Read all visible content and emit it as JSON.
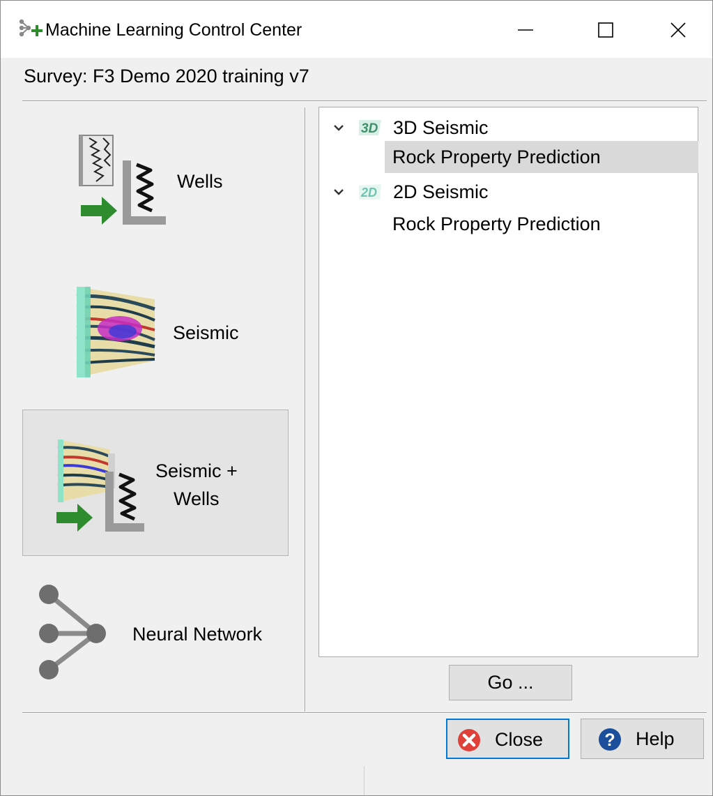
{
  "window": {
    "title": "Machine Learning Control Center",
    "icon": "ml-network-plus-icon",
    "controls": [
      "minimize-icon",
      "maximize-icon",
      "close-icon"
    ]
  },
  "survey_label": "Survey: F3 Demo 2020 training v7",
  "tools": [
    {
      "label": "Wells",
      "icon": "wells-icon",
      "selected": false
    },
    {
      "label": "Seismic",
      "icon": "seismic-icon",
      "selected": false
    },
    {
      "label_line1": "Seismic +",
      "label_line2": "Wells",
      "icon": "seismic-wells-icon",
      "selected": true
    },
    {
      "label": "Neural Network",
      "icon": "neural-network-icon",
      "selected": false
    }
  ],
  "tree": {
    "groups": [
      {
        "badge": "3D",
        "label": "3D Seismic",
        "expanded": true,
        "children": [
          {
            "label": "Rock Property Prediction",
            "selected": true
          }
        ]
      },
      {
        "badge": "2D",
        "label": "2D Seismic",
        "expanded": true,
        "children": [
          {
            "label": "Rock Property Prediction",
            "selected": false
          }
        ]
      }
    ]
  },
  "buttons": {
    "go": "Go ...",
    "close": "Close",
    "help": "Help"
  },
  "colors": {
    "accent": "#0078d7",
    "close_icon_red": "#e0403a",
    "help_icon_blue": "#1b4f9c",
    "arrow_green": "#2e8b2e",
    "badge_3d": "#3f8f6a",
    "badge_2d": "#6fc3b0"
  }
}
